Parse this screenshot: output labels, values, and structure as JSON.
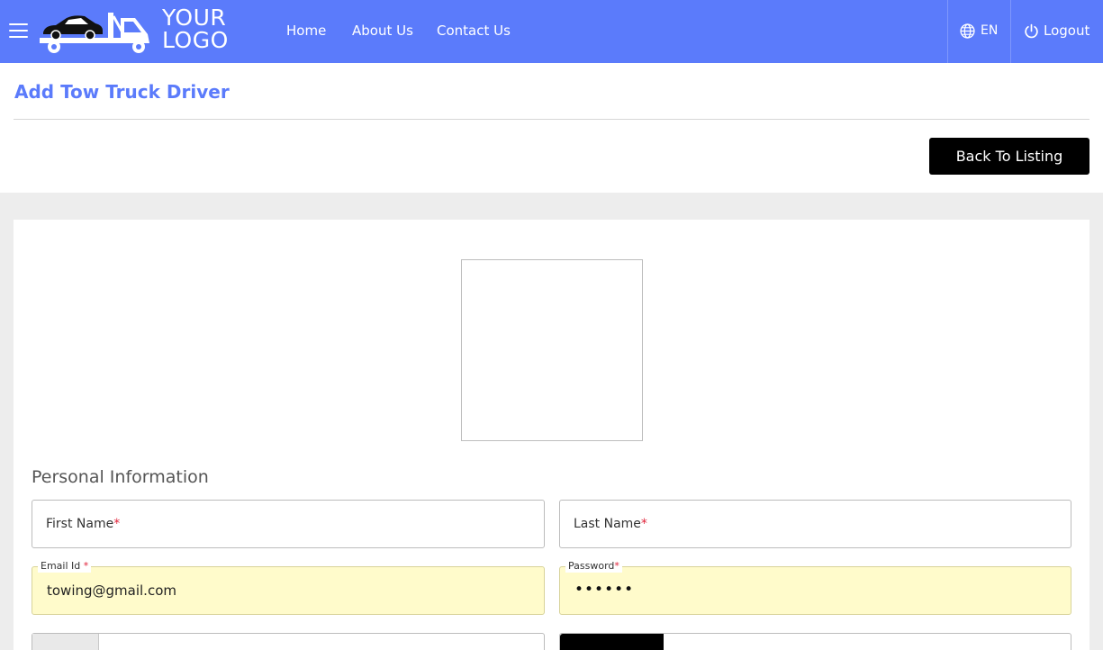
{
  "nav": {
    "logo_line1": "YOUR",
    "logo_line2": "LOGO",
    "links": [
      "Home",
      "About Us",
      "Contact Us"
    ],
    "language": "EN",
    "logout": "Logout"
  },
  "header": {
    "title": "Add Tow Truck Driver",
    "back_button": "Back To Listing"
  },
  "form": {
    "section_title": "Personal Information",
    "first_name_label": "First Name",
    "last_name_label": "Last Name",
    "email_label": "Email Id",
    "email_value": "towing@gmail.com",
    "password_label": "Password",
    "password_mask": "••••••",
    "required_mark": "*"
  },
  "colors": {
    "brand": "#5b7bfb",
    "autofill": "#fffbcb",
    "required": "#e0233a"
  }
}
